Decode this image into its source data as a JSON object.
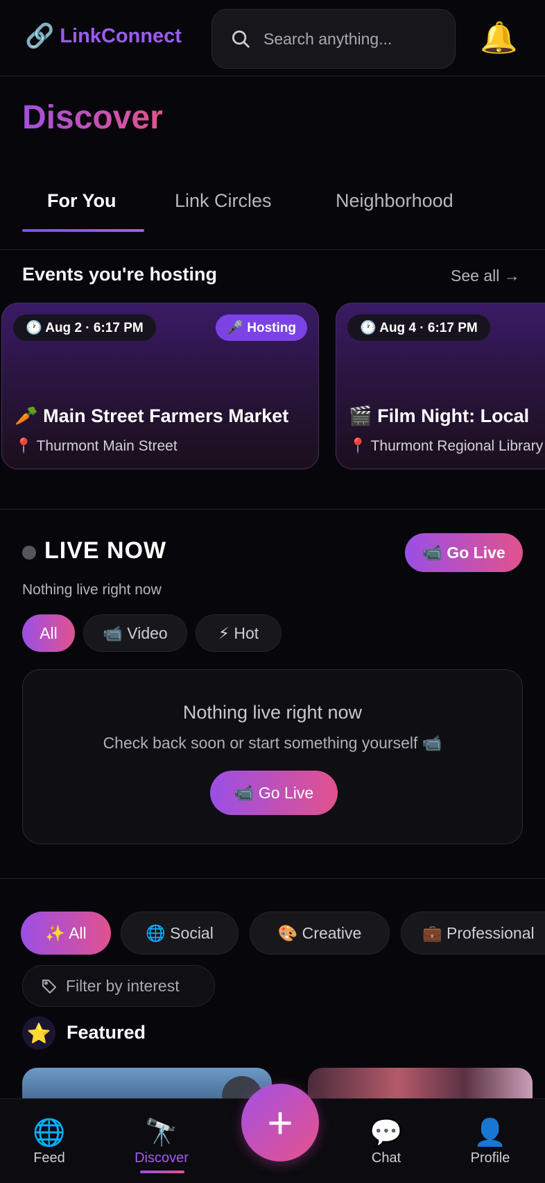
{
  "header": {
    "logo_icon": "link-icon",
    "logo_text": "LinkConnect",
    "search_placeholder": "Search anything...",
    "bell_icon": "bell-icon"
  },
  "page_title": "Discover",
  "tabs": [
    {
      "label": "For You",
      "active": true
    },
    {
      "label": "Link Circles",
      "active": false
    },
    {
      "label": "Neighborhood",
      "active": false
    }
  ],
  "hosting": {
    "title": "Events you're hosting",
    "see_all": "See all →",
    "events": [
      {
        "time": "🕐 Aug 2 · 6:17 PM",
        "badge": "🎤 Hosting",
        "title": "🥕 Main Street Farmers Market",
        "location": "📍 Thurmont Main Street"
      },
      {
        "time": "🕐 Aug 4 · 6:17 PM",
        "badge": "",
        "title": "🎬 Film Night: Local",
        "location": "📍 Thurmont Regional Library"
      }
    ]
  },
  "live": {
    "title": "LIVE NOW",
    "go_live": "📹 Go Live",
    "subtitle": "Nothing live right now",
    "filters": [
      "All",
      "📹 Video",
      "⚡ Hot"
    ],
    "empty_title": "Nothing live right now",
    "empty_sub": "Check back soon or start something yourself 📹",
    "empty_button": "📹 Go Live"
  },
  "interests": {
    "pills": [
      "✨  All",
      "🌐  Social",
      "🎨  Creative",
      "💼  Professional"
    ],
    "filter_placeholder": "Filter by interest",
    "featured_title": "Featured",
    "featured_icon": "⭐"
  },
  "nav": {
    "items": [
      {
        "icon": "🌐",
        "label": "Feed"
      },
      {
        "icon": "🔭",
        "label": "Discover"
      },
      {
        "icon": "💬",
        "label": "Chat"
      },
      {
        "icon": "👤",
        "label": "Profile"
      }
    ],
    "fab": "+"
  },
  "colors": {
    "accent_purple": "#9b5cf0",
    "accent_pink": "#e2528d",
    "background": "#07070b"
  }
}
